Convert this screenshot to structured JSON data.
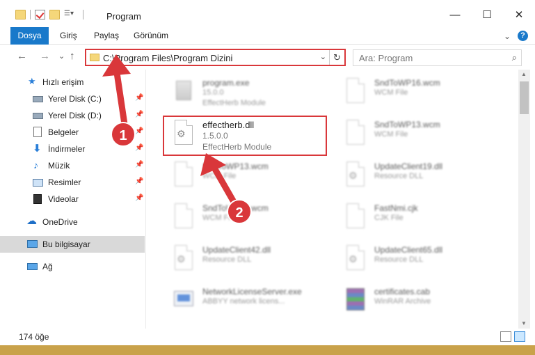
{
  "window": {
    "title": "Program",
    "minimize": "—",
    "maximize": "☐",
    "close": "✕"
  },
  "ribbon": {
    "tabs": [
      "Dosya",
      "Giriş",
      "Paylaş",
      "Görünüm"
    ],
    "expand": "⌄",
    "help": "?"
  },
  "nav": {
    "back": "←",
    "forward": "→",
    "recent": "⌄",
    "up": "↑"
  },
  "address": {
    "path": "C:\\Program Files\\Program Dizini",
    "dropdown": "⌄",
    "refresh": "↻"
  },
  "search": {
    "placeholder": "Ara: Program"
  },
  "sidebar": {
    "items": [
      {
        "label": "Hızlı erişim"
      },
      {
        "label": "Yerel Disk (C:)"
      },
      {
        "label": "Yerel Disk (D:)"
      },
      {
        "label": "Belgeler"
      },
      {
        "label": "İndirmeler"
      },
      {
        "label": "Müzik"
      },
      {
        "label": "Resimler"
      },
      {
        "label": "Videolar"
      },
      {
        "label": "OneDrive"
      },
      {
        "label": "Bu bilgisayar"
      },
      {
        "label": "Ağ"
      }
    ]
  },
  "files": [
    {
      "name": "program.exe",
      "line2": "15.0.0",
      "line3": "EffectHerb Module"
    },
    {
      "name": "SndToWP16.wcm",
      "line2": "WCM File",
      "line3": ""
    },
    {
      "name": "effectherb.dll",
      "line2": "1.5.0.0",
      "line3": "EffectHerb Module"
    },
    {
      "name": "SndToWP13.wcm",
      "line2": "WCM File",
      "line3": ""
    },
    {
      "name": "SndToWP13.wcm",
      "line2": "WCM File",
      "line3": ""
    },
    {
      "name": "UpdateClient19.dll",
      "line2": "Resource DLL",
      "line3": ""
    },
    {
      "name": "SndToWP16.wcm",
      "line2": "WCM File",
      "line3": ""
    },
    {
      "name": "FastNmi.cjk",
      "line2": "CJK File",
      "line3": ""
    },
    {
      "name": "UpdateClient42.dll",
      "line2": "Resource DLL",
      "line3": ""
    },
    {
      "name": "UpdateClient65.dll",
      "line2": "Resource DLL",
      "line3": ""
    },
    {
      "name": "NetworkLicenseServer.exe",
      "line2": "ABBYY network licens...",
      "line3": ""
    },
    {
      "name": "certificates.cab",
      "line2": "WinRAR Archive",
      "line3": ""
    }
  ],
  "status": {
    "count": "174 öğe"
  },
  "annotations": {
    "step1": "1",
    "step2": "2"
  }
}
